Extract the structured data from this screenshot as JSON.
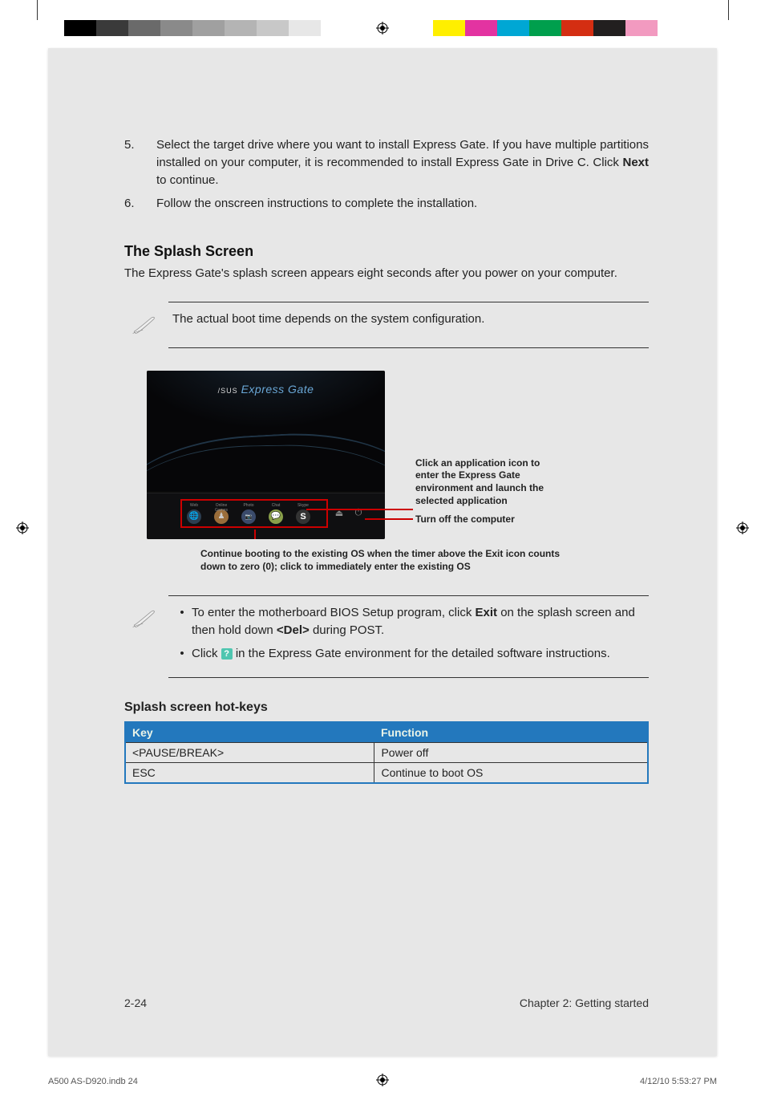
{
  "steps": [
    {
      "num": "5.",
      "text_before": "Select the target drive where you want to install Express Gate. If you have multiple partitions installed on your computer, it is recommended to install Express Gate in Drive C. Click ",
      "bold1": "Next",
      "text_after": " to continue."
    },
    {
      "num": "6.",
      "text_before": "Follow the onscreen instructions to complete the installation.",
      "bold1": "",
      "text_after": ""
    }
  ],
  "h2": "The Splash Screen",
  "intro": "The Express Gate's splash screen appears eight seconds after you power on your computer.",
  "note1": "The actual boot time depends on the system configuration.",
  "callouts": {
    "app": "Click an application icon to enter the Express Gate environment and launch the selected application",
    "power": "Turn off the computer",
    "exit": "Continue booting to the existing OS when the timer above the Exit icon counts down to zero (0); click to immediately enter the existing OS"
  },
  "splash_logo_brand": "/SUS",
  "splash_logo_text": "Express Gate",
  "dock_labels": [
    "Web",
    "Online Games",
    "Photo",
    "Chat",
    "Skype"
  ],
  "note2": {
    "li1_before": "To enter the motherboard BIOS Setup program, click ",
    "li1_b1": "Exit",
    "li1_mid": " on the splash screen and then hold down ",
    "li1_b2": "<Del>",
    "li1_after": " during POST.",
    "li2_before": "Click ",
    "li2_after": " in the Express Gate environment for the detailed software instructions."
  },
  "h3": "Splash screen hot-keys",
  "table": {
    "head": [
      "Key",
      "Function"
    ],
    "rows": [
      [
        "<PAUSE/BREAK>",
        "Power off"
      ],
      [
        "ESC",
        "Continue to boot OS"
      ]
    ]
  },
  "footer": {
    "page": "2-24",
    "chapter": "Chapter 2: Getting started"
  },
  "indb": {
    "left": "A500 AS-D920.indb   24",
    "right": "4/12/10   5:53:27 PM"
  },
  "help_glyph": "?"
}
